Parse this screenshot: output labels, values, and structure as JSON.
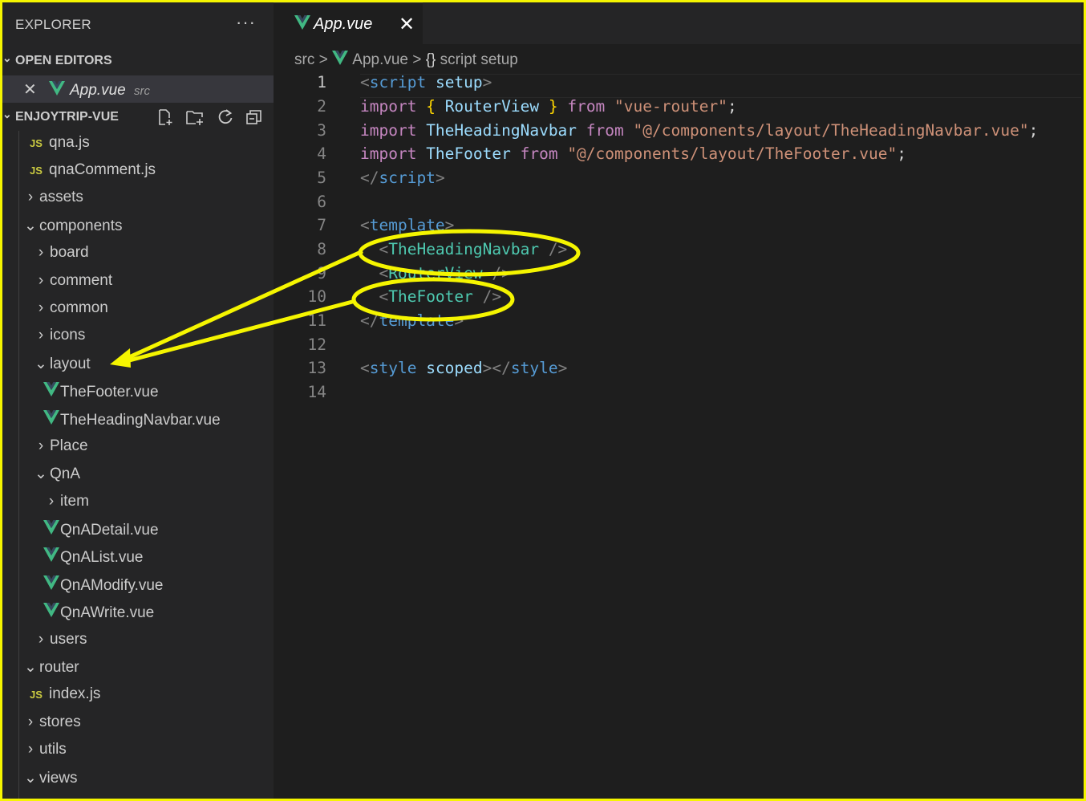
{
  "explorer": {
    "title": "EXPLORER",
    "more": "···",
    "open_editors": "OPEN EDITORS",
    "open_file": {
      "name": "App.vue",
      "dir": "src",
      "close": "✕"
    },
    "project": "ENJOYTRIP-VUE"
  },
  "tree": [
    {
      "label": "qna.js",
      "type": "js"
    },
    {
      "label": "qnaComment.js",
      "type": "js"
    },
    {
      "label": "assets",
      "type": "folder-closed"
    },
    {
      "label": "components",
      "type": "folder-open"
    },
    {
      "label": "board",
      "type": "folder-closed"
    },
    {
      "label": "comment",
      "type": "folder-closed"
    },
    {
      "label": "common",
      "type": "folder-closed"
    },
    {
      "label": "icons",
      "type": "folder-closed"
    },
    {
      "label": "layout",
      "type": "folder-open"
    },
    {
      "label": "TheFooter.vue",
      "type": "vue"
    },
    {
      "label": "TheHeadingNavbar.vue",
      "type": "vue"
    },
    {
      "label": "Place",
      "type": "folder-closed"
    },
    {
      "label": "QnA",
      "type": "folder-open"
    },
    {
      "label": "item",
      "type": "folder-closed"
    },
    {
      "label": "QnADetail.vue",
      "type": "vue"
    },
    {
      "label": "QnAList.vue",
      "type": "vue"
    },
    {
      "label": "QnAModify.vue",
      "type": "vue"
    },
    {
      "label": "QnAWrite.vue",
      "type": "vue"
    },
    {
      "label": "users",
      "type": "folder-closed"
    },
    {
      "label": "router",
      "type": "folder-open"
    },
    {
      "label": "index.js",
      "type": "js"
    },
    {
      "label": "stores",
      "type": "folder-closed"
    },
    {
      "label": "utils",
      "type": "folder-closed"
    },
    {
      "label": "views",
      "type": "folder-open"
    }
  ],
  "js_badge": "JS",
  "editor": {
    "tab": {
      "name": "App.vue",
      "close": "✕"
    },
    "breadcrumb": {
      "src": "src",
      "file": "App.vue",
      "symbol": "script setup",
      "symbol_icon": "{}",
      "sep": ">"
    }
  },
  "line_numbers": [
    "1",
    "2",
    "3",
    "4",
    "5",
    "6",
    "7",
    "8",
    "9",
    "10",
    "11",
    "12",
    "13",
    "14"
  ],
  "code": {
    "l1": {
      "a": "<",
      "b": "script",
      "c": " ",
      "d": "setup",
      "e": ">"
    },
    "l2": {
      "a": "import",
      "b": " ",
      "c": "{",
      "d": " RouterView ",
      "e": "}",
      "f": " from ",
      "g": "\"vue-router\"",
      "h": ";"
    },
    "l3": {
      "a": "import",
      "b": " TheHeadingNavbar",
      "c": " from ",
      "d": "\"@/components/layout/TheHeadingNavbar.vue\"",
      "e": ";"
    },
    "l4": {
      "a": "import",
      "b": " TheFooter",
      "c": " from ",
      "d": "\"@/components/layout/TheFooter.vue\"",
      "e": ";"
    },
    "l5": {
      "a": "</",
      "b": "script",
      "c": ">"
    },
    "l7": {
      "a": "<",
      "b": "template",
      "c": ">"
    },
    "l8": {
      "a": "  <",
      "b": "TheHeadingNavbar",
      "c": " />"
    },
    "l9": {
      "a": "  <",
      "b": "RouterView",
      "c": " />"
    },
    "l10": {
      "a": "  <",
      "b": "TheFooter",
      "c": " />"
    },
    "l11": {
      "a": "</",
      "b": "template",
      "c": ">"
    },
    "l13": {
      "a": "<",
      "b": "style",
      "c": " ",
      "d": "scoped",
      "e": "></",
      "f": "style",
      "g": ">"
    }
  },
  "colors": {
    "highlight": "#f5f500",
    "vue": "#41b883",
    "js": "#cbcb41"
  }
}
